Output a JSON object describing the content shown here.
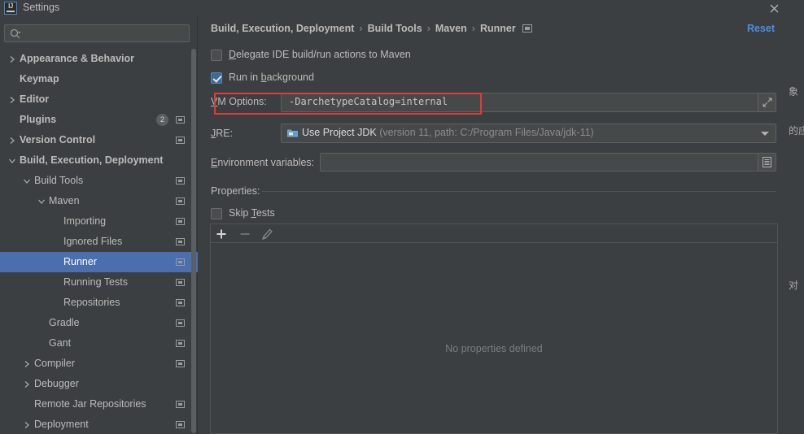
{
  "window": {
    "title": "Settings",
    "app_icon": "intellij-idea-logo",
    "close_icon": "close-icon"
  },
  "sidebar": {
    "search": {
      "value": "",
      "placeholder": "",
      "icon": "search-icon"
    },
    "items": [
      {
        "label": "Appearance & Behavior",
        "indent": 1,
        "chevron": "right",
        "bold": true,
        "badge": null,
        "mod_icon": false,
        "selected": false
      },
      {
        "label": "Keymap",
        "indent": 1,
        "chevron": "none",
        "bold": true,
        "badge": null,
        "mod_icon": false,
        "selected": false
      },
      {
        "label": "Editor",
        "indent": 1,
        "chevron": "right",
        "bold": true,
        "badge": null,
        "mod_icon": false,
        "selected": false
      },
      {
        "label": "Plugins",
        "indent": 1,
        "chevron": "none",
        "bold": true,
        "badge": "2",
        "mod_icon": true,
        "selected": false
      },
      {
        "label": "Version Control",
        "indent": 1,
        "chevron": "right",
        "bold": true,
        "badge": null,
        "mod_icon": true,
        "selected": false
      },
      {
        "label": "Build, Execution, Deployment",
        "indent": 1,
        "chevron": "down",
        "bold": true,
        "badge": null,
        "mod_icon": false,
        "selected": false
      },
      {
        "label": "Build Tools",
        "indent": 2,
        "chevron": "down",
        "bold": false,
        "badge": null,
        "mod_icon": true,
        "selected": false
      },
      {
        "label": "Maven",
        "indent": 3,
        "chevron": "down",
        "bold": false,
        "badge": null,
        "mod_icon": true,
        "selected": false
      },
      {
        "label": "Importing",
        "indent": 4,
        "chevron": "none",
        "bold": false,
        "badge": null,
        "mod_icon": true,
        "selected": false
      },
      {
        "label": "Ignored Files",
        "indent": 4,
        "chevron": "none",
        "bold": false,
        "badge": null,
        "mod_icon": true,
        "selected": false
      },
      {
        "label": "Runner",
        "indent": 4,
        "chevron": "none",
        "bold": false,
        "badge": null,
        "mod_icon": true,
        "selected": true
      },
      {
        "label": "Running Tests",
        "indent": 4,
        "chevron": "none",
        "bold": false,
        "badge": null,
        "mod_icon": true,
        "selected": false
      },
      {
        "label": "Repositories",
        "indent": 4,
        "chevron": "none",
        "bold": false,
        "badge": null,
        "mod_icon": true,
        "selected": false
      },
      {
        "label": "Gradle",
        "indent": 3,
        "chevron": "none",
        "bold": false,
        "badge": null,
        "mod_icon": true,
        "selected": false
      },
      {
        "label": "Gant",
        "indent": 3,
        "chevron": "none",
        "bold": false,
        "badge": null,
        "mod_icon": true,
        "selected": false
      },
      {
        "label": "Compiler",
        "indent": 2,
        "chevron": "right",
        "bold": false,
        "badge": null,
        "mod_icon": true,
        "selected": false
      },
      {
        "label": "Debugger",
        "indent": 2,
        "chevron": "right",
        "bold": false,
        "badge": null,
        "mod_icon": false,
        "selected": false
      },
      {
        "label": "Remote Jar Repositories",
        "indent": 2,
        "chevron": "none",
        "bold": false,
        "badge": null,
        "mod_icon": true,
        "selected": false
      },
      {
        "label": "Deployment",
        "indent": 2,
        "chevron": "right",
        "bold": false,
        "badge": null,
        "mod_icon": true,
        "selected": false
      }
    ]
  },
  "content": {
    "breadcrumb": {
      "crumbs": [
        "Build, Execution, Deployment",
        "Build Tools",
        "Maven",
        "Runner"
      ],
      "separator": "›",
      "trailing_icon": "settings-module-icon"
    },
    "reset_label": "Reset",
    "delegate_checkbox": {
      "label_pre": "",
      "mnemonic": "D",
      "label_post": "elegate IDE build/run actions to Maven",
      "checked": false
    },
    "background_checkbox": {
      "label_pre": "Run in ",
      "mnemonic": "b",
      "label_post": "ackground",
      "checked": true
    },
    "vm_options": {
      "label_mnemonic": "V",
      "label_rest": "M Options:",
      "value": "-DarchetypeCatalog=internal",
      "expand_icon": "expand-arrows-icon"
    },
    "jre": {
      "label_mnemonic": "J",
      "label_rest": "RE:",
      "icon": "jdk-folder-icon",
      "value_main": "Use Project JDK",
      "value_detail": "(version 11, path: C:/Program Files/Java/jdk-11)",
      "arrow_icon": "chevron-down-icon"
    },
    "env_vars": {
      "label_mnemonic": "E",
      "label_rest": "nvironment variables:",
      "value": "",
      "browse_icon": "list-editor-icon"
    },
    "properties_section": {
      "title": "Properties:",
      "skip_tests": {
        "label_pre": "Skip ",
        "mnemonic": "T",
        "label_post": "ests",
        "checked": false
      },
      "toolbar": {
        "add_icon": "plus-icon",
        "remove_icon": "minus-icon",
        "edit_icon": "pencil-icon"
      },
      "empty_text": "No properties defined"
    }
  },
  "annotation": {
    "color": "#e03b3b",
    "target": "vm-options-row"
  },
  "background_window": {
    "fragments": [
      "象",
      "的应",
      "对"
    ]
  },
  "colors": {
    "dialog_bg": "#3c3f41",
    "selection_blue": "#4b6eaf",
    "link_blue": "#4a8ee0",
    "field_bg": "#45494a",
    "border": "#5e6060",
    "text": "#bbbbbb",
    "muted_text": "#8c8c8c",
    "annotation_red": "#e03b3b"
  }
}
